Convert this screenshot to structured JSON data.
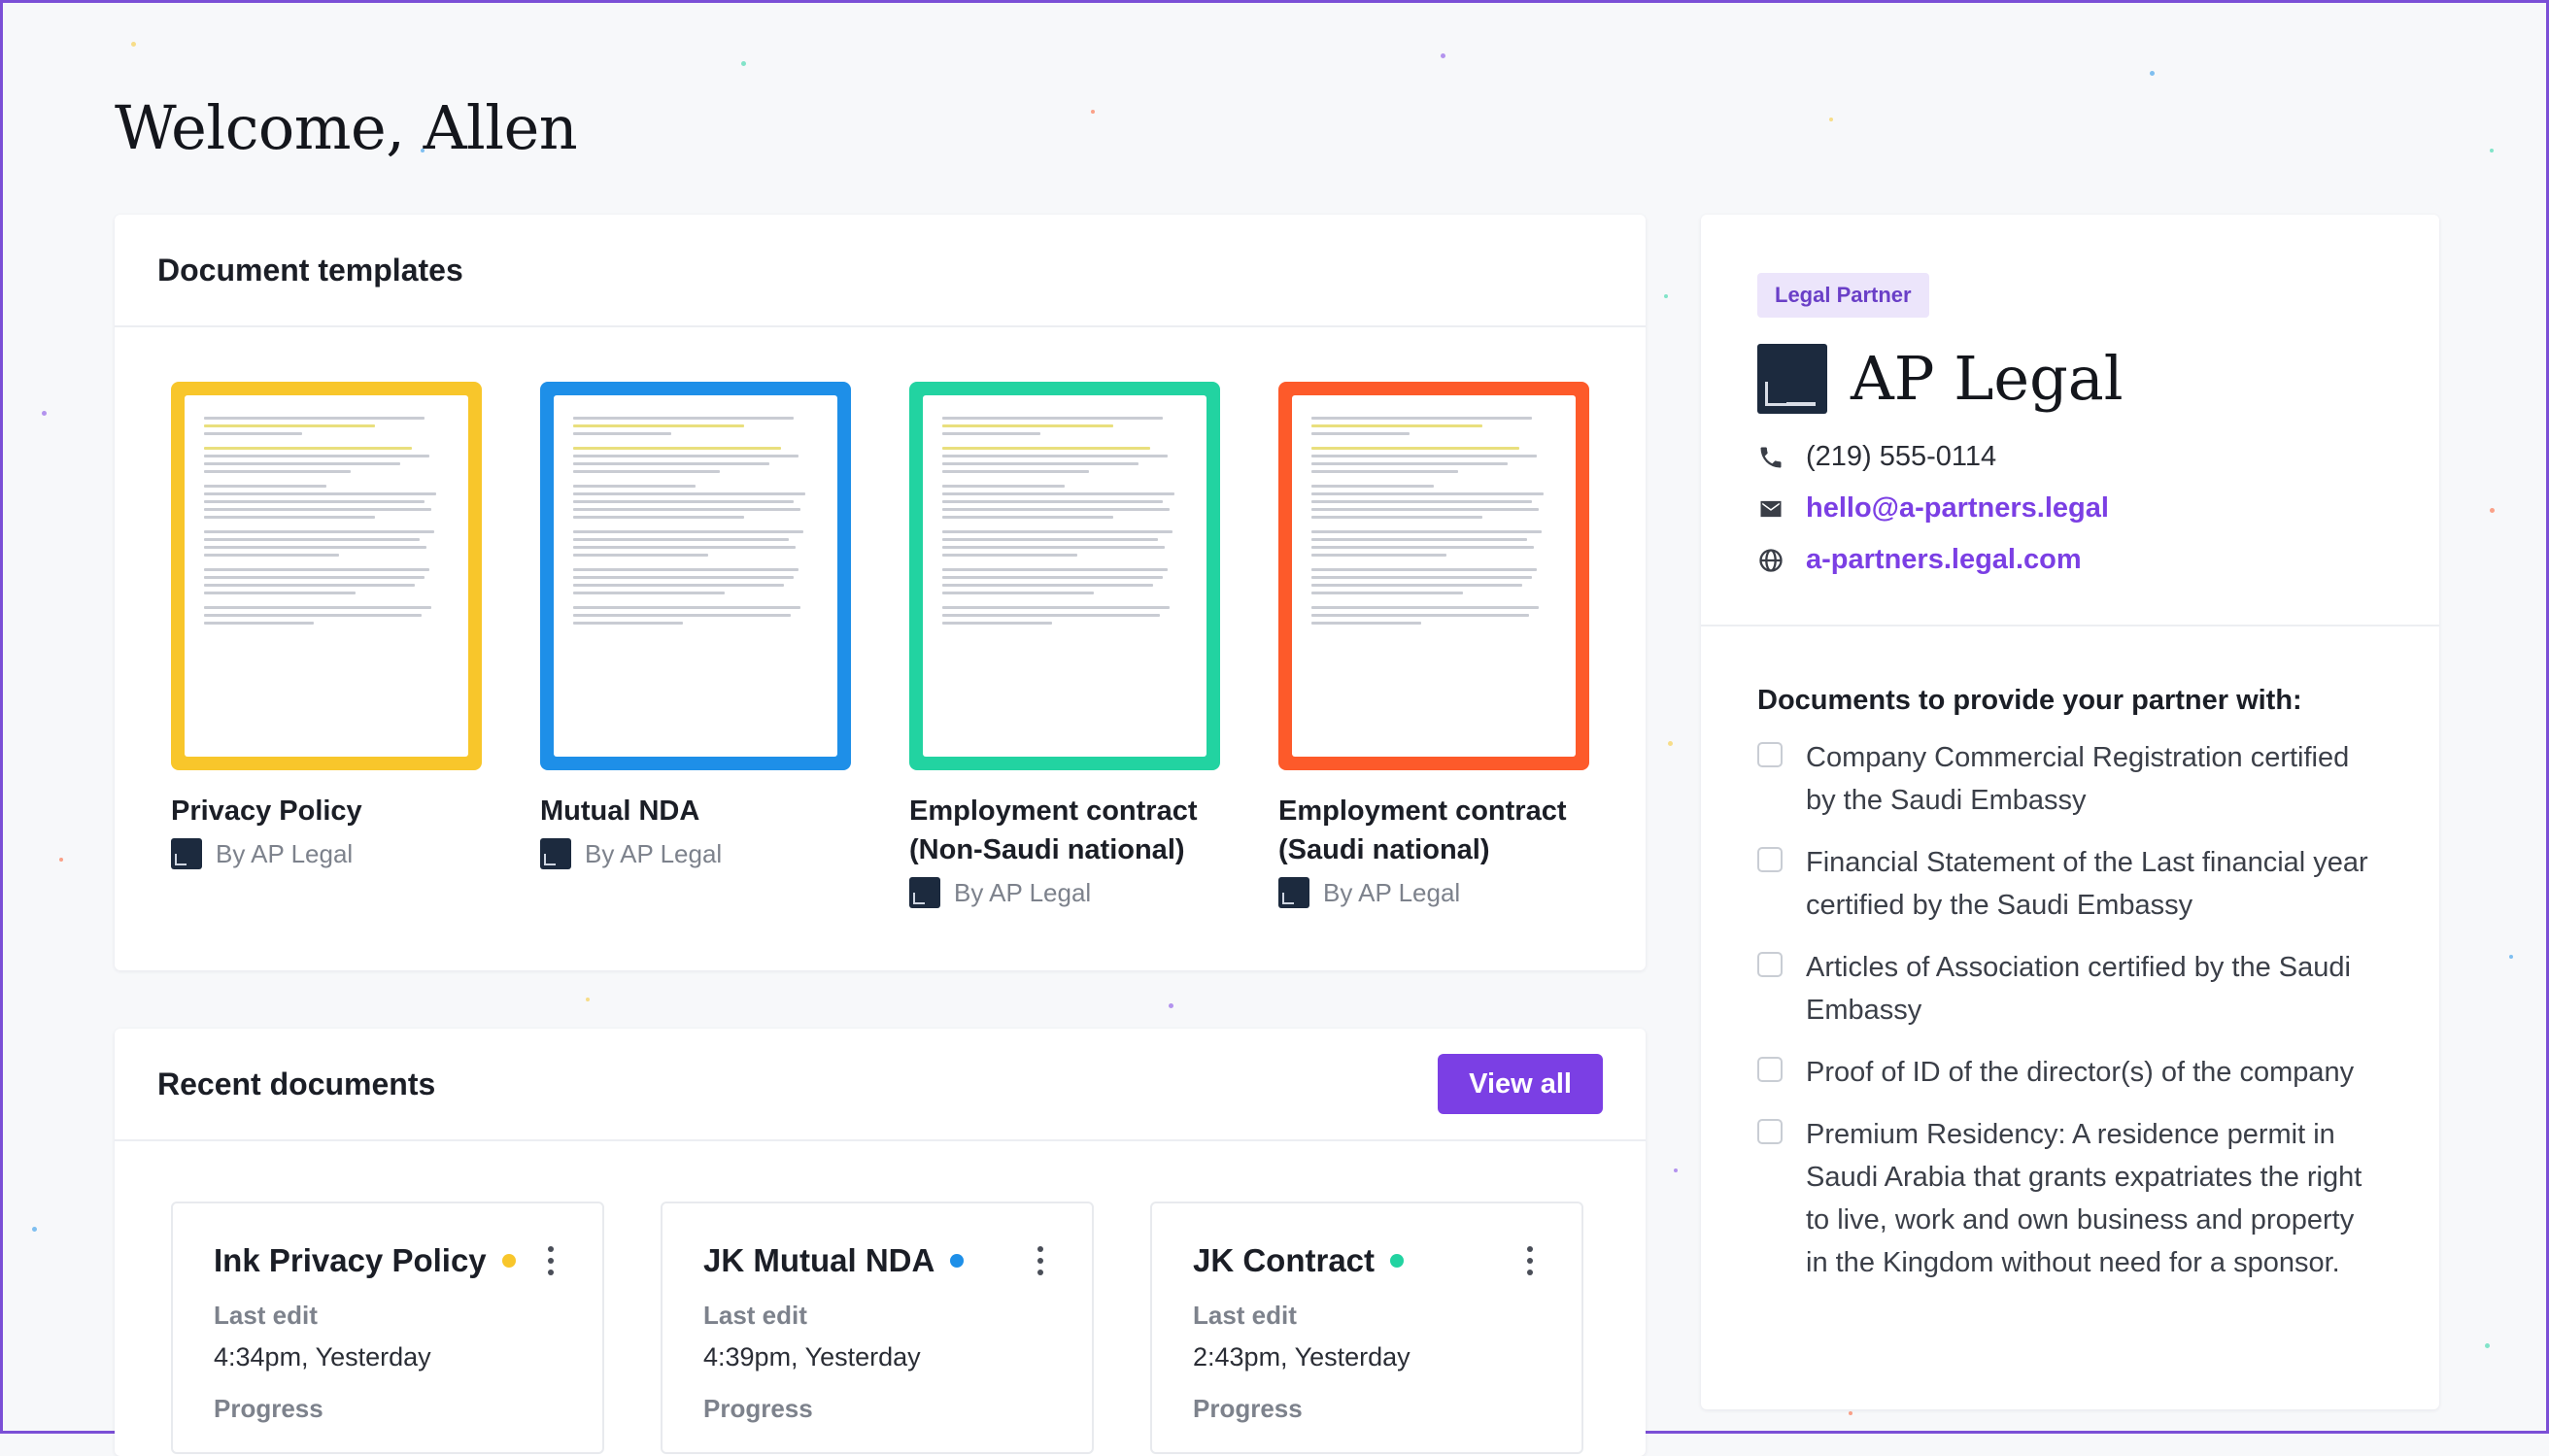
{
  "greeting": "Welcome, Allen",
  "templates_panel": {
    "title": "Document templates",
    "items": [
      {
        "name": "Privacy Policy",
        "by": "By AP Legal",
        "color": "#f8c62b"
      },
      {
        "name": "Mutual NDA",
        "by": "By AP Legal",
        "color": "#1e8fe8"
      },
      {
        "name": "Employment contract (Non-Saudi national)",
        "by": "By AP Legal",
        "color": "#22d3a1"
      },
      {
        "name": "Employment contract (Saudi national)",
        "by": "By AP Legal",
        "color": "#fd5a2a"
      }
    ]
  },
  "recent_panel": {
    "title": "Recent documents",
    "view_all": "View all",
    "items": [
      {
        "title": "Ink Privacy Policy",
        "dot": "#f8c62b",
        "last_edit_label": "Last edit",
        "last_edit": "4:34pm, Yesterday",
        "progress_label": "Progress"
      },
      {
        "title": "JK Mutual NDA",
        "dot": "#1e8fe8",
        "last_edit_label": "Last edit",
        "last_edit": "4:39pm, Yesterday",
        "progress_label": "Progress"
      },
      {
        "title": "JK Contract",
        "dot": "#22d3a1",
        "last_edit_label": "Last edit",
        "last_edit": "2:43pm, Yesterday",
        "progress_label": "Progress"
      }
    ]
  },
  "partner": {
    "badge": "Legal Partner",
    "name": "AP Legal",
    "phone": "(219) 555-0114",
    "email": "hello@a-partners.legal",
    "website": "a-partners.legal.com",
    "docs_title": "Documents to provide your partner with:",
    "docs": [
      "Company Commercial Registration certified by the Saudi Embassy",
      "Financial Statement of the Last financial year certified by the Saudi Embassy",
      "Articles of Association certified by the Saudi Embassy",
      "Proof of ID of the director(s) of the company",
      "Premium Residency: A residence permit in Saudi Arabia that grants expatriates the right to live, work and own business and property in the Kingdom without need for a sponsor."
    ]
  },
  "colors": {
    "accent": "#7b3fe4",
    "border": "#7b4fd6"
  }
}
